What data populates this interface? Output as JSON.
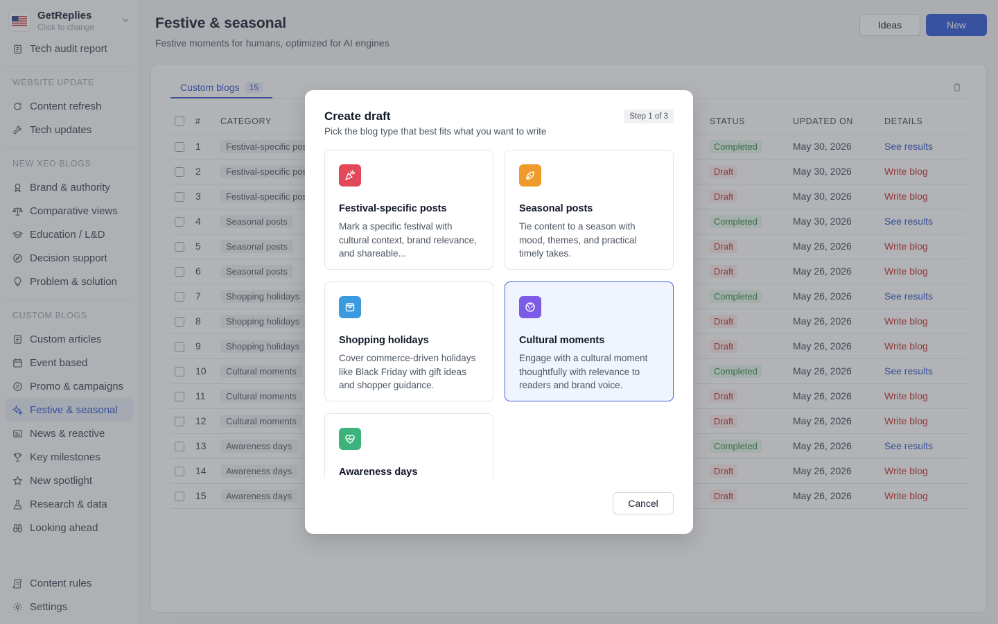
{
  "brand": {
    "name": "GetReplies",
    "sub": "Click to change"
  },
  "sidebar": {
    "top_item": "Tech audit report",
    "sections": [
      {
        "title": "WEBSITE UPDATE",
        "items": [
          "Content refresh",
          "Tech updates"
        ]
      },
      {
        "title": "NEW XEO BLOGS",
        "items": [
          "Brand & authority",
          "Comparative views",
          "Education / L&D",
          "Decision support",
          "Problem & solution"
        ]
      },
      {
        "title": "CUSTOM BLOGS",
        "items": [
          "Custom articles",
          "Event based",
          "Promo & campaigns",
          "Festive & seasonal",
          "News & reactive",
          "Key milestones",
          "New spotlight",
          "Research & data",
          "Looking ahead"
        ]
      }
    ],
    "bottom": [
      "Content rules",
      "Settings"
    ]
  },
  "header": {
    "title": "Festive & seasonal",
    "subtitle": "Festive moments for humans, optimized for AI engines",
    "ideas_label": "Ideas",
    "new_label": "New"
  },
  "tabs": [
    {
      "label": "Custom blogs",
      "count": "15"
    }
  ],
  "table": {
    "columns": {
      "num": "#",
      "category": "CATEGORY",
      "status": "STATUS",
      "updated": "UPDATED ON",
      "details": "DETAILS"
    },
    "rows": [
      {
        "num": "1",
        "category": "Festival-specific posts",
        "status": "Completed",
        "updated": "May 30, 2026",
        "details": "See results"
      },
      {
        "num": "2",
        "category": "Festival-specific posts",
        "status": "Draft",
        "updated": "May 30, 2026",
        "details": "Write blog"
      },
      {
        "num": "3",
        "category": "Festival-specific posts",
        "status": "Draft",
        "updated": "May 30, 2026",
        "details": "Write blog"
      },
      {
        "num": "4",
        "category": "Seasonal posts",
        "status": "Completed",
        "updated": "May 30, 2026",
        "details": "See results"
      },
      {
        "num": "5",
        "category": "Seasonal posts",
        "status": "Draft",
        "updated": "May 26, 2026",
        "details": "Write blog"
      },
      {
        "num": "6",
        "category": "Seasonal posts",
        "status": "Draft",
        "updated": "May 26, 2026",
        "details": "Write blog"
      },
      {
        "num": "7",
        "category": "Shopping holidays",
        "status": "Completed",
        "updated": "May 26, 2026",
        "details": "See results"
      },
      {
        "num": "8",
        "category": "Shopping holidays",
        "status": "Draft",
        "updated": "May 26, 2026",
        "details": "Write blog"
      },
      {
        "num": "9",
        "category": "Shopping holidays",
        "status": "Draft",
        "updated": "May 26, 2026",
        "details": "Write blog"
      },
      {
        "num": "10",
        "category": "Cultural moments",
        "status": "Completed",
        "updated": "May 26, 2026",
        "details": "See results"
      },
      {
        "num": "11",
        "category": "Cultural moments",
        "status": "Draft",
        "updated": "May 26, 2026",
        "details": "Write blog"
      },
      {
        "num": "12",
        "category": "Cultural moments",
        "status": "Draft",
        "updated": "May 26, 2026",
        "details": "Write blog"
      },
      {
        "num": "13",
        "category": "Awareness days",
        "status": "Completed",
        "updated": "May 26, 2026",
        "details": "See results"
      },
      {
        "num": "14",
        "category": "Awareness days",
        "status": "Draft",
        "updated": "May 26, 2026",
        "details": "Write blog"
      },
      {
        "num": "15",
        "category": "Awareness days",
        "status": "Draft",
        "updated": "May 26, 2026",
        "details": "Write blog"
      }
    ]
  },
  "modal": {
    "title": "Create draft",
    "subtitle": "Pick the blog type that best fits what you want to write",
    "step": "Step 1 of 3",
    "options": [
      {
        "title": "Festival-specific posts",
        "desc": "Mark a specific festival with cultural context, brand relevance, and shareable...",
        "icon": "party-popper-icon",
        "color": "#e2475a"
      },
      {
        "title": "Seasonal posts",
        "desc": "Tie content to a season with mood, themes, and practical timely takes.",
        "icon": "leaf-icon",
        "color": "#ef9b2b"
      },
      {
        "title": "Shopping holidays",
        "desc": "Cover commerce-driven holidays like Black Friday with gift ideas and shopper guidance.",
        "icon": "shopping-bag-icon",
        "color": "#3b9be0"
      },
      {
        "title": "Cultural moments",
        "desc": "Engage with a cultural moment thoughtfully with relevance to readers and brand voice.",
        "icon": "globe-icon",
        "color": "#7c5ce6",
        "selected": true
      },
      {
        "title": "Awareness days",
        "desc": "",
        "icon": "heart-pulse-icon",
        "color": "#3cb37a"
      }
    ],
    "cancel_label": "Cancel"
  }
}
